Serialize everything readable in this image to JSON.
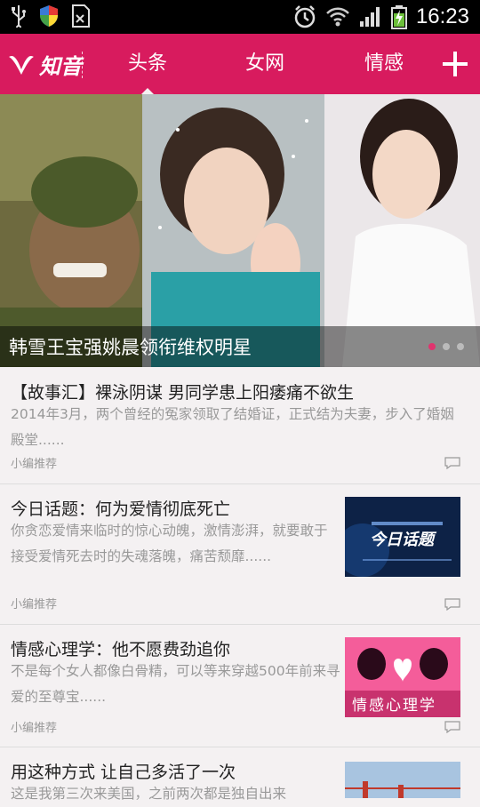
{
  "status": {
    "time": "16:23"
  },
  "header": {
    "logo_text": "知音",
    "tabs": [
      {
        "label": "头条",
        "active": true
      },
      {
        "label": "女网",
        "active": false
      },
      {
        "label": "情感",
        "active": false
      }
    ],
    "add_icon": "plus-icon",
    "accent_color": "#d81b5e"
  },
  "banner": {
    "caption": "韩雪王宝强姚晨领衔维权明星",
    "dots_total": 3,
    "dots_active": 1
  },
  "articles": [
    {
      "title": "【故事汇】裸泳阴谋 男同学患上阳痿痛不欲生",
      "summary": "2014年3月，两个曾经的冤家领取了结婚证，正式结为夫妻，步入了婚姻殿堂......",
      "source": "小编推荐"
    },
    {
      "title": "今日话题：何为爱情彻底死亡",
      "summary": "你贪恋爱情来临时的惊心动魄，激情澎湃，就要敢于接受爱情死去时的失魂落魄，痛苦颓靡......",
      "source": "小编推荐",
      "thumb_text": "今日话题"
    },
    {
      "title": "情感心理学：他不愿费劲追你",
      "summary": "不是每个女人都像白骨精，可以等来穿越500年前来寻爱的至尊宝......",
      "source": "小编推荐",
      "thumb_text": "情感心理学"
    },
    {
      "title": "用这种方式 让自己多活了一次",
      "summary": "这是我第三次来美国，之前两次都是独自出来"
    }
  ]
}
